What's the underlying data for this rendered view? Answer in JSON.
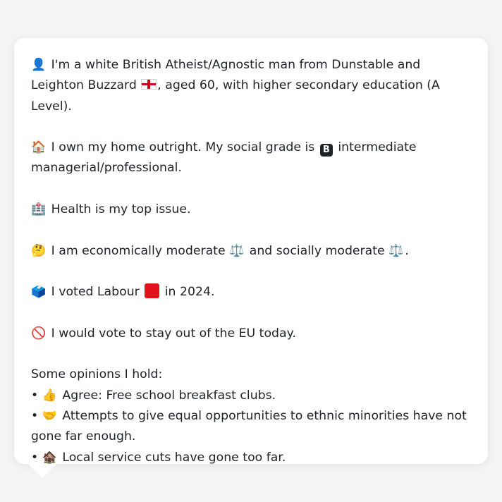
{
  "persona": {
    "intro_icon": "👤",
    "intro_a": "I'm a white British Atheist/Agnostic man from Dunstable and Leighton Buzzard",
    "intro_b": ", aged 60, with higher secondary education (A Level).",
    "home_icon": "🏠",
    "home_a": "I own my home outright. My social grade is",
    "grade_badge": "B",
    "home_b": "intermediate managerial/professional.",
    "health_icon": "🏥",
    "health_text": "Health is my top issue.",
    "thinking_icon": "🤔",
    "econ_a": "I am economically moderate",
    "scale_icon": "⚖️",
    "econ_b": "and socially moderate",
    "econ_c": ".",
    "vote_icon": "🗳️",
    "vote_a": "I voted Labour",
    "vote_b": "in 2024.",
    "eu_icon": "🚫",
    "eu_text": "I would vote to stay out of the EU today.",
    "opinions_heading": "Some opinions I hold:",
    "bullet": "•",
    "op1_icon": "👍",
    "op1_text": "Agree: Free school breakfast clubs.",
    "op2_icon": "🤝",
    "op2_text": "Attempts to give equal opportunities to ethnic minorities have not gone far enough.",
    "op3_icon": "🏚️",
    "op3_text": "Local service cuts have gone too far."
  },
  "colors": {
    "background": "#f3f4f6",
    "card": "#ffffff",
    "text": "#1f2328",
    "labour_red": "#e3131b"
  }
}
